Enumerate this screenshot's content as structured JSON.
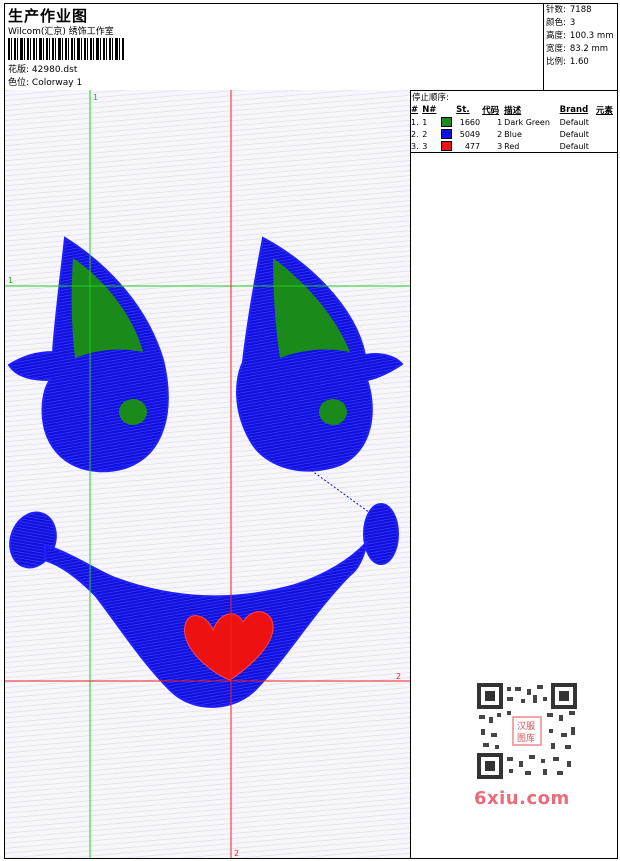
{
  "header": {
    "title": "生产作业图",
    "studio": "Wilcom(汇京) 绣饰工作室",
    "design_label": "花版:",
    "design_value": "42980.dst",
    "colorway_label": "色位:",
    "colorway_value": "Colorway 1"
  },
  "stats": {
    "stitches_label": "针数:",
    "stitches_value": "7188",
    "colors_label": "颜色:",
    "colors_value": "3",
    "height_label": "高度:",
    "height_value": "100.3 mm",
    "width_label": "宽度:",
    "width_value": "83.2 mm",
    "scale_label": "比例:",
    "scale_value": "1.60"
  },
  "stop_sequence": {
    "heading": "停止顺序:",
    "columns": [
      "#",
      "N#",
      "St.",
      "代码",
      "描述",
      "Brand",
      "元素"
    ],
    "rows": [
      {
        "idx": "1.",
        "n": "1",
        "color": "#1a8a1a",
        "stitches": "1660",
        "code": "1",
        "desc": "Dark Green",
        "brand": "Default",
        "element": ""
      },
      {
        "idx": "2.",
        "n": "2",
        "color": "#1010e0",
        "stitches": "5049",
        "code": "2",
        "desc": "Blue",
        "brand": "Default",
        "element": ""
      },
      {
        "idx": "3.",
        "n": "3",
        "color": "#ee1111",
        "stitches": "477",
        "code": "3",
        "desc": "Red",
        "brand": "Default",
        "element": ""
      }
    ]
  },
  "guides": {
    "v1_label": "1",
    "h1_label": "1",
    "h2_label": "2",
    "v2_label": "2",
    "green": "#22cc22",
    "red": "#ee2222"
  },
  "design_colors": {
    "green": "#1a8a1a",
    "blue": "#1010e0",
    "red": "#ee1111"
  },
  "watermark": {
    "text": "6xiu.com",
    "stamp": "汉服图库"
  }
}
